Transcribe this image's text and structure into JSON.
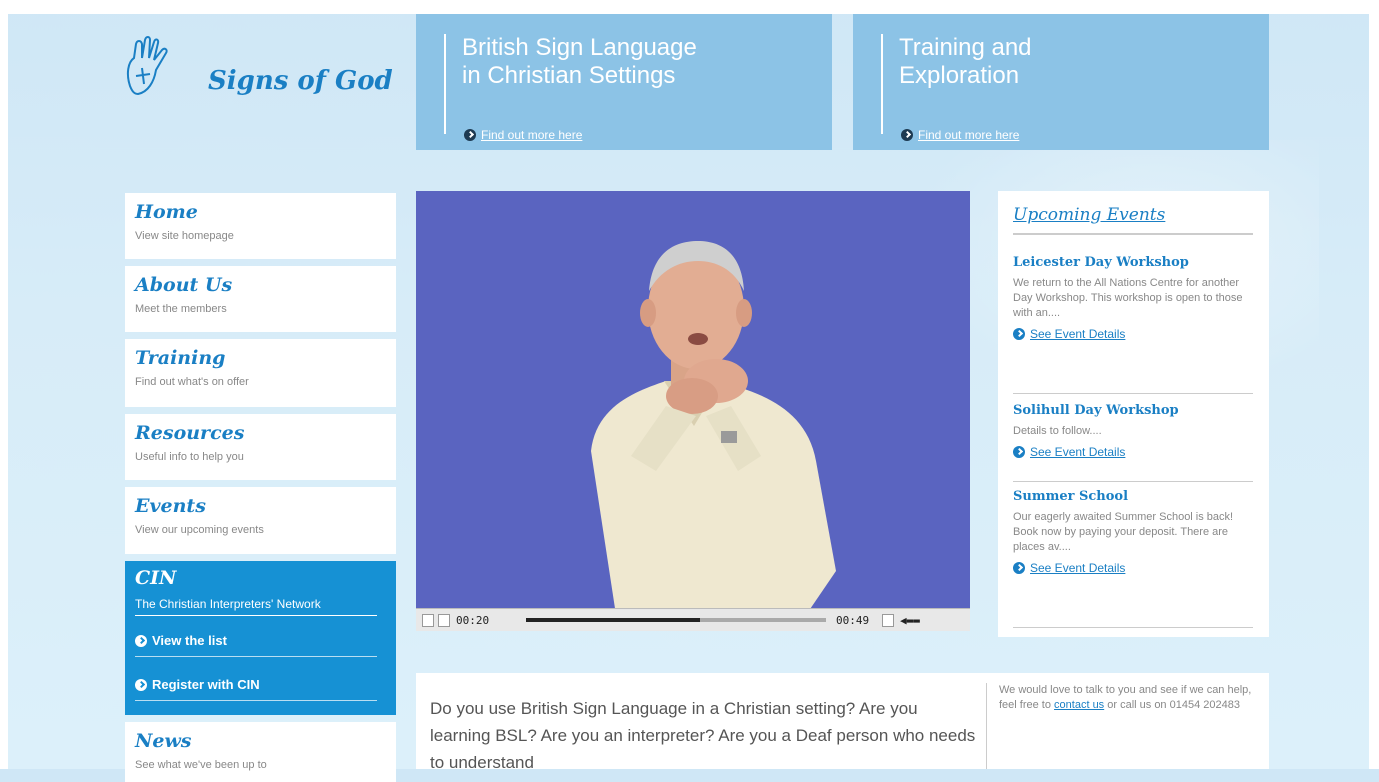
{
  "logo": {
    "text": "Signs of God",
    "icon": "hand-cross-icon"
  },
  "banners": [
    {
      "title": "British Sign Language\nin Christian Settings",
      "link": "Find out more here"
    },
    {
      "title": "Training and\nExploration",
      "link": "Find out more here"
    }
  ],
  "nav": [
    {
      "title": "Home",
      "sub": "View site homepage"
    },
    {
      "title": "About Us",
      "sub": "Meet the members"
    },
    {
      "title": "Training",
      "sub": "Find out what's on offer"
    },
    {
      "title": "Resources",
      "sub": "Useful info to help you"
    },
    {
      "title": "Events",
      "sub": "View our upcoming events"
    }
  ],
  "cin": {
    "title": "CIN",
    "sub": "The Christian Interpreters' Network",
    "links": [
      "View the list",
      "Register with CIN"
    ]
  },
  "news": {
    "title": "News",
    "sub": "See what we've been up to"
  },
  "video": {
    "elapsed": "00:20",
    "total": "00:49",
    "progress": 0.58
  },
  "events": {
    "heading": "Upcoming Events",
    "items": [
      {
        "title": "Leicester Day Workshop",
        "body": "We return to the All Nations Centre for another Day Workshop. This workshop is open to those with an....",
        "link": "See Event Details"
      },
      {
        "title": "Solihull Day Workshop",
        "body": "Details to follow....",
        "link": "See Event Details"
      },
      {
        "title": "Summer School",
        "body": "Our eagerly awaited Summer School is back! Book now by paying your deposit. There are places av....",
        "link": "See Event Details"
      }
    ]
  },
  "intro": {
    "text": "Do you use British Sign Language in a Christian setting? Are you learning BSL? Are you an interpreter? Are you a Deaf person who needs to understand",
    "contact_before": "We would love to talk to you and see if we can help, feel free to ",
    "contact_link": "contact us",
    "contact_after": " or call us on 01454 202483"
  },
  "colors": {
    "brand_blue": "#1a7fc4",
    "cin_blue": "#1691d4",
    "banner_blue": "#8cc3e6"
  }
}
